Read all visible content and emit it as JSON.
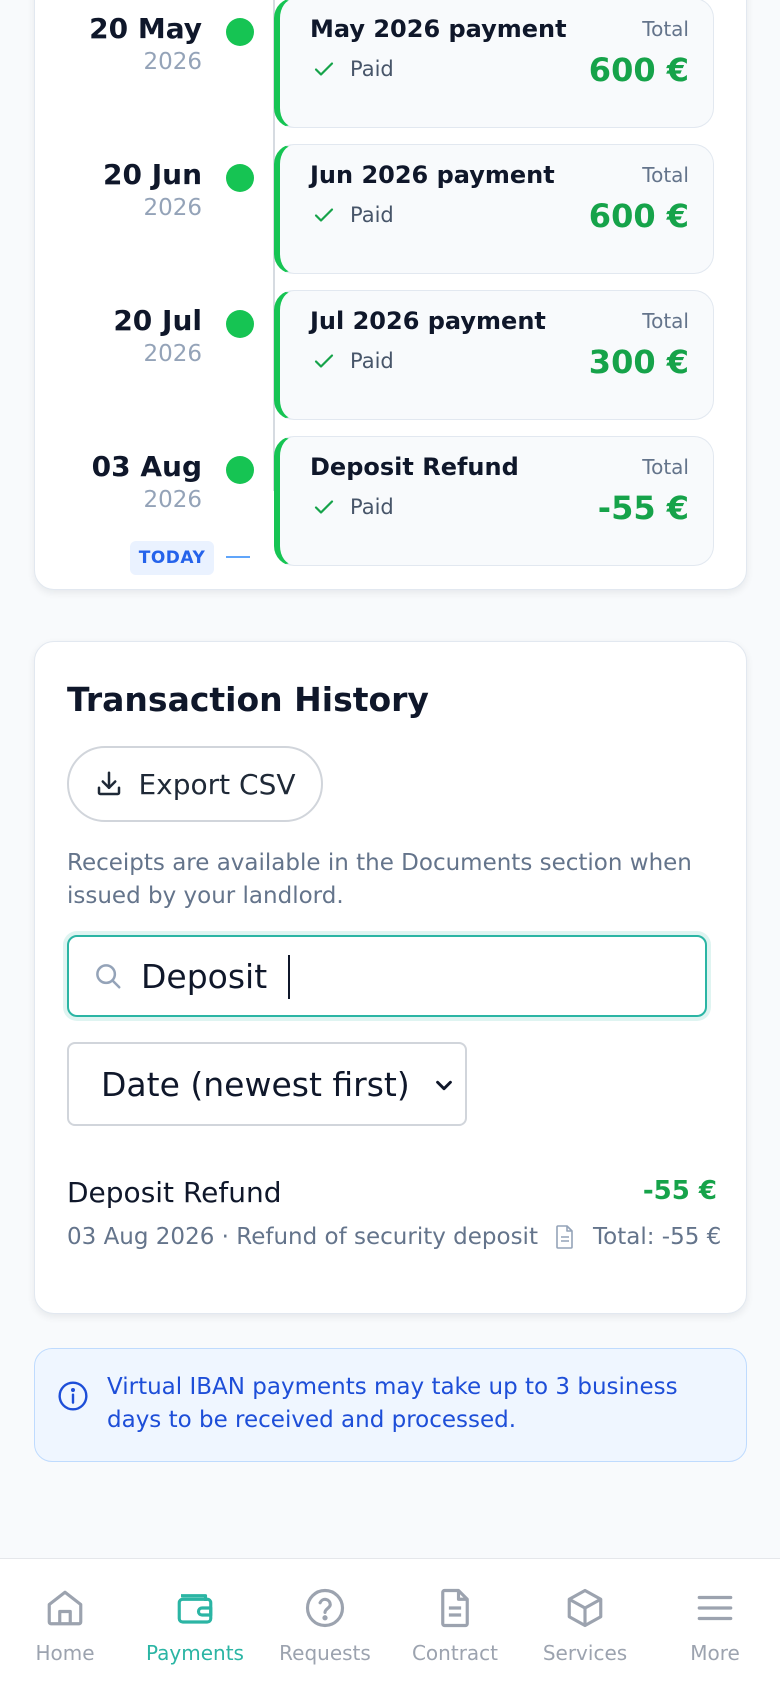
{
  "timeline": {
    "entries": [
      {
        "date": "20 May",
        "year": "2026",
        "title": "May 2026 payment",
        "status": "Paid",
        "total_label": "Total",
        "amount": "600 €"
      },
      {
        "date": "20 Jun",
        "year": "2026",
        "title": "Jun 2026 payment",
        "status": "Paid",
        "total_label": "Total",
        "amount": "600 €"
      },
      {
        "date": "20 Jul",
        "year": "2026",
        "title": "Jul 2026 payment",
        "status": "Paid",
        "total_label": "Total",
        "amount": "300 €"
      },
      {
        "date": "03 Aug",
        "year": "2026",
        "title": "Deposit Refund",
        "status": "Paid",
        "total_label": "Total",
        "amount": "-55 €"
      }
    ],
    "today_label": "TODAY"
  },
  "history": {
    "title": "Transaction History",
    "export_label": "Export CSV",
    "receipts_note": "Receipts are available in the Documents section when issued by your landlord.",
    "search_value": "Deposit",
    "sort_selected": "Date (newest first)",
    "transactions": [
      {
        "title": "Deposit Refund",
        "amount": "-55 €",
        "subtitle": "03 Aug 2026 · Refund of security deposit",
        "total_text": "Total: -55 €"
      }
    ]
  },
  "info_banner": {
    "text": "Virtual IBAN payments may take up to 3 business days to be received and processed."
  },
  "nav": {
    "items": [
      {
        "label": "Home",
        "icon": "home-icon"
      },
      {
        "label": "Payments",
        "icon": "wallet-icon"
      },
      {
        "label": "Requests",
        "icon": "help-circle-icon"
      },
      {
        "label": "Contract",
        "icon": "document-icon"
      },
      {
        "label": "Services",
        "icon": "box-icon"
      },
      {
        "label": "More",
        "icon": "menu-icon"
      }
    ],
    "active": "Payments"
  },
  "colors": {
    "accent": "#2bb5a4",
    "paid_green": "#16c453",
    "amount_green": "#16a34a",
    "info_blue": "#1d4ed8"
  }
}
